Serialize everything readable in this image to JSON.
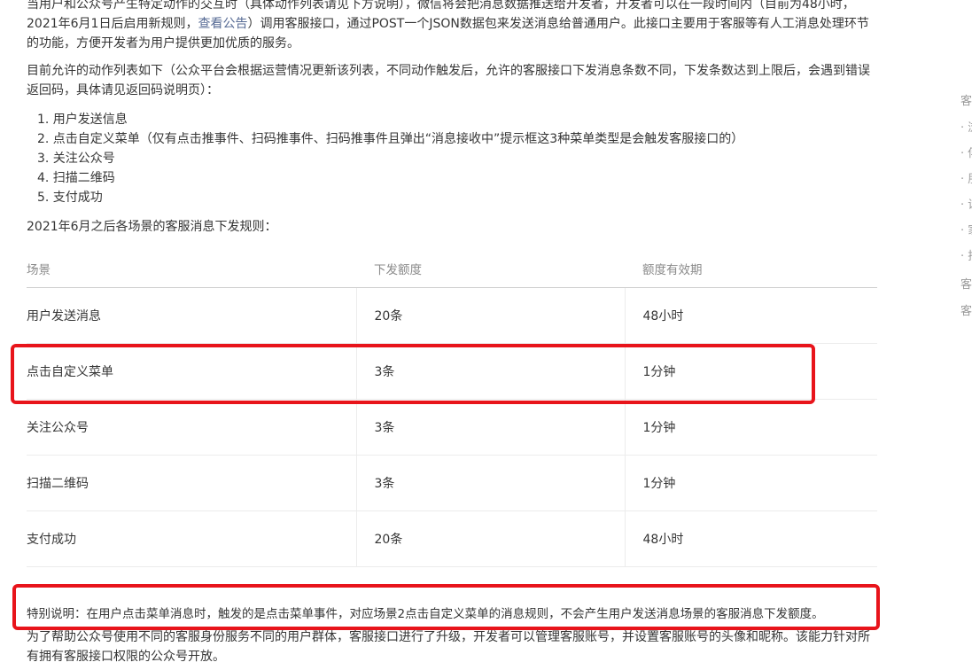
{
  "intro": {
    "line1": "当用户和公众号产生特定动作的交互时（具体动作列表请见下方说明），微信将会把消息数据推送给开发者，开发者可以在一段时间内（目前为48小时，",
    "line2_before_link": "2021年6月1日后启用新规则，",
    "link": "查看公告",
    "line2_after_link": "）调用客服接口，通过POST一个JSON数据包来发送消息给普通用户。此接口主要用于客服等有人工消息处理环节",
    "line3": "的功能，方便开发者为用户提供更加优质的服务。"
  },
  "allowed": {
    "line1": "目前允许的动作列表如下（公众平台会根据运营情况更新该列表，不同动作触发后，允许的客服接口下发消息条数不同，下发条数达到上限后，会遇到错误",
    "line2": "返回码，具体请见返回码说明页）："
  },
  "actions": [
    "1. 用户发送信息",
    "2. 点击自定义菜单（仅有点击推事件、扫码推事件、扫码推事件且弹出“消息接收中”提示框这3种菜单类型是会触发客服接口的）",
    "3. 关注公众号",
    "4. 扫描二维码",
    "5. 支付成功"
  ],
  "rules_title": "2021年6月之后各场景的客服消息下发规则：",
  "table": {
    "headers": [
      "场景",
      "下发额度",
      "额度有效期"
    ],
    "rows": [
      [
        "用户发送消息",
        "20条",
        "48小时"
      ],
      [
        "点击自定义菜单",
        "3条",
        "1分钟"
      ],
      [
        "关注公众号",
        "3条",
        "1分钟"
      ],
      [
        "扫描二维码",
        "3条",
        "1分钟"
      ],
      [
        "支付成功",
        "20条",
        "48小时"
      ]
    ]
  },
  "note": "特别说明：在用户点击菜单消息时，触发的是点击菜单事件，对应场景2点击自定义菜单的消息规则，不会产生用户发送消息场景的客服消息下发额度。",
  "upgrade": {
    "line1": "为了帮助公众号使用不同的客服身份服务不同的用户群体，客服接口进行了升级，开发者可以管理客服账号，并设置客服账号的头像和昵称。该能力针对所",
    "line2": "有拥有客服接口权限的公众号开放。"
  },
  "sidebar": [
    "客",
    "· 浏",
    "· 傅",
    "· 朋",
    "· 设",
    "· 家",
    "· 拒",
    "客",
    "客"
  ],
  "colors": {
    "highlight": "#e8141b",
    "link": "#576b95"
  }
}
